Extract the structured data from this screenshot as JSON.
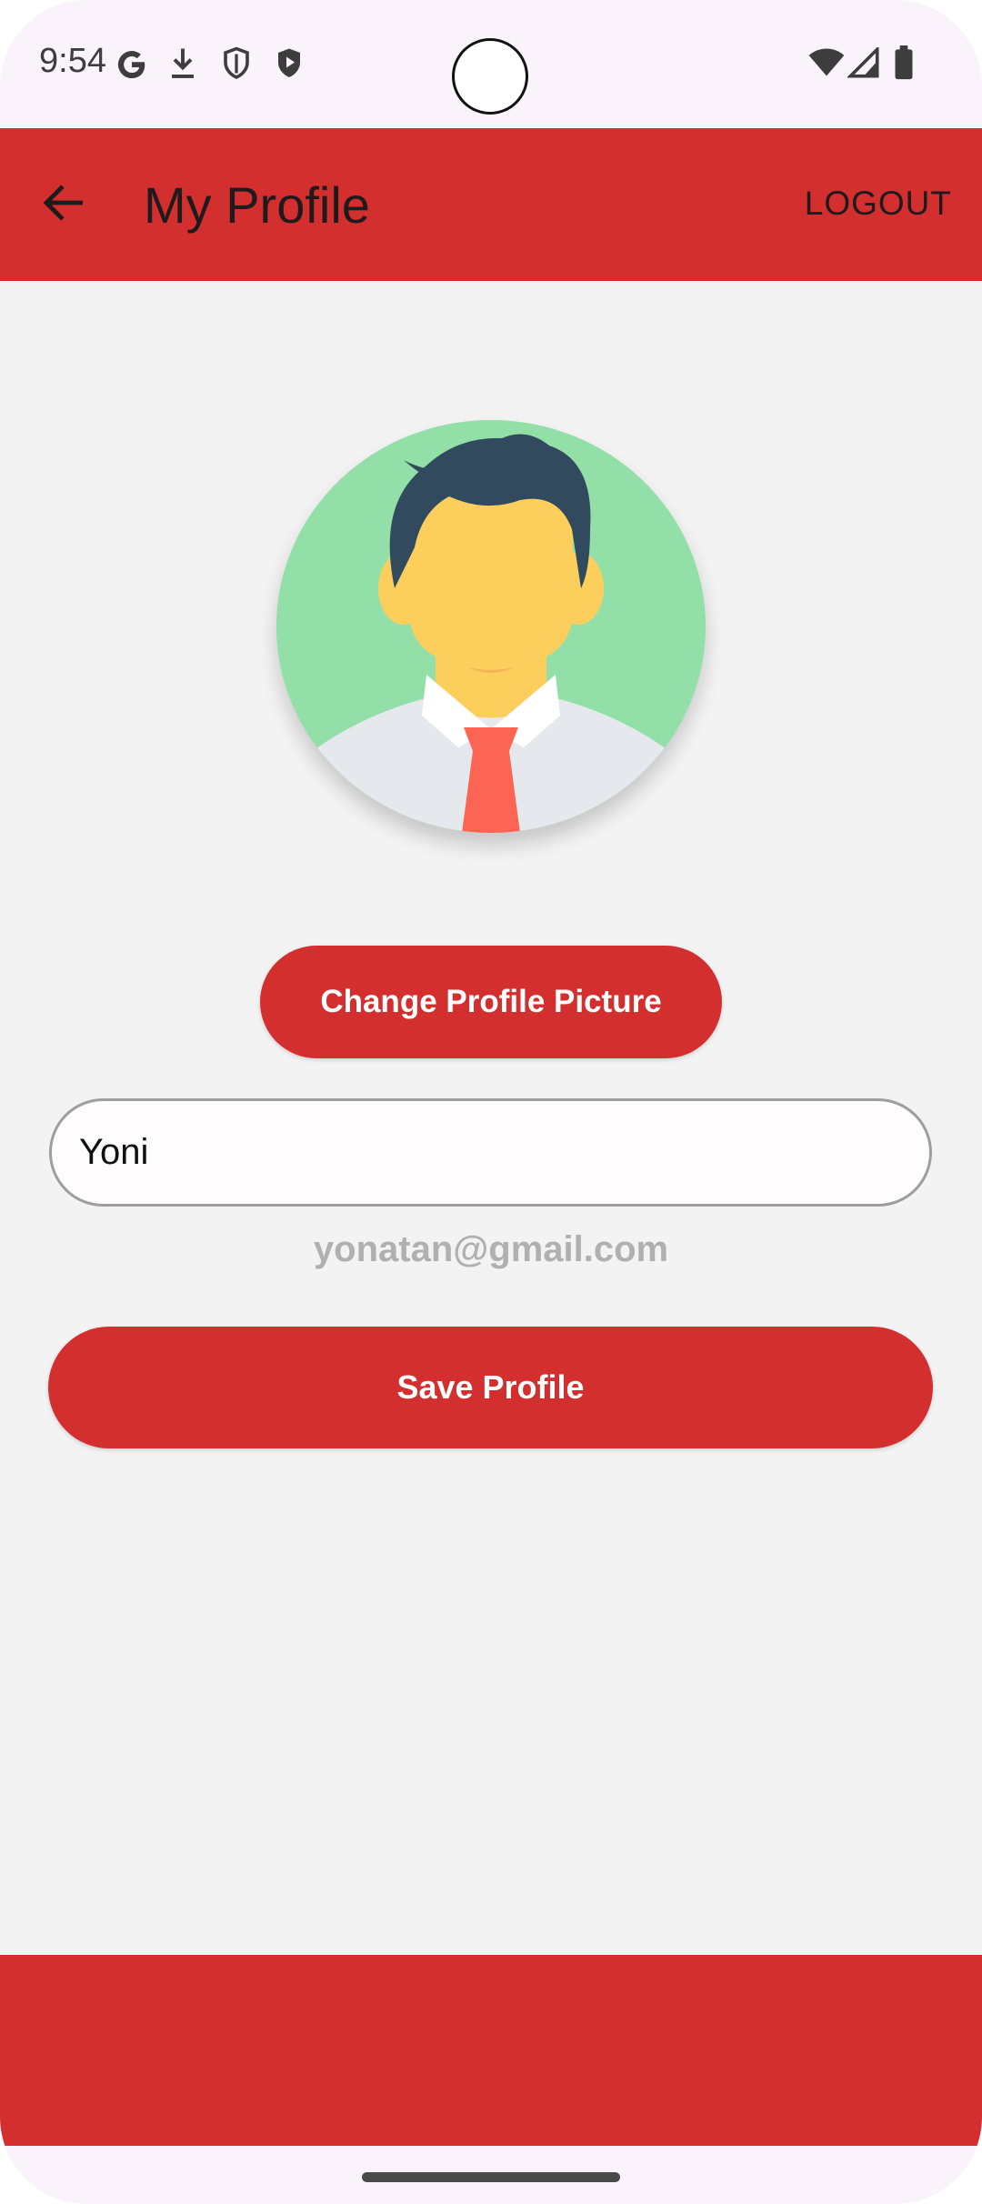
{
  "status_bar": {
    "time": "9:54",
    "left_icons": [
      "google-g-icon",
      "download-icon",
      "shield-outline-icon",
      "shield-play-icon"
    ],
    "right_icons": [
      "wifi-icon",
      "cell-signal-icon",
      "battery-icon"
    ]
  },
  "app_bar": {
    "title": "My Profile",
    "back_icon": "arrow-back-icon",
    "logout_label": "LOGOUT"
  },
  "profile": {
    "avatar": "person-avatar",
    "change_picture_label": "Change Profile Picture",
    "name_value": "Yoni",
    "email": "yonatan@gmail.com",
    "save_label": "Save Profile"
  },
  "colors": {
    "primary": "#d32f2f",
    "background": "#f3f3f3",
    "status_bar": "#fbf3fc",
    "avatar_bg": "#92e0a8"
  }
}
